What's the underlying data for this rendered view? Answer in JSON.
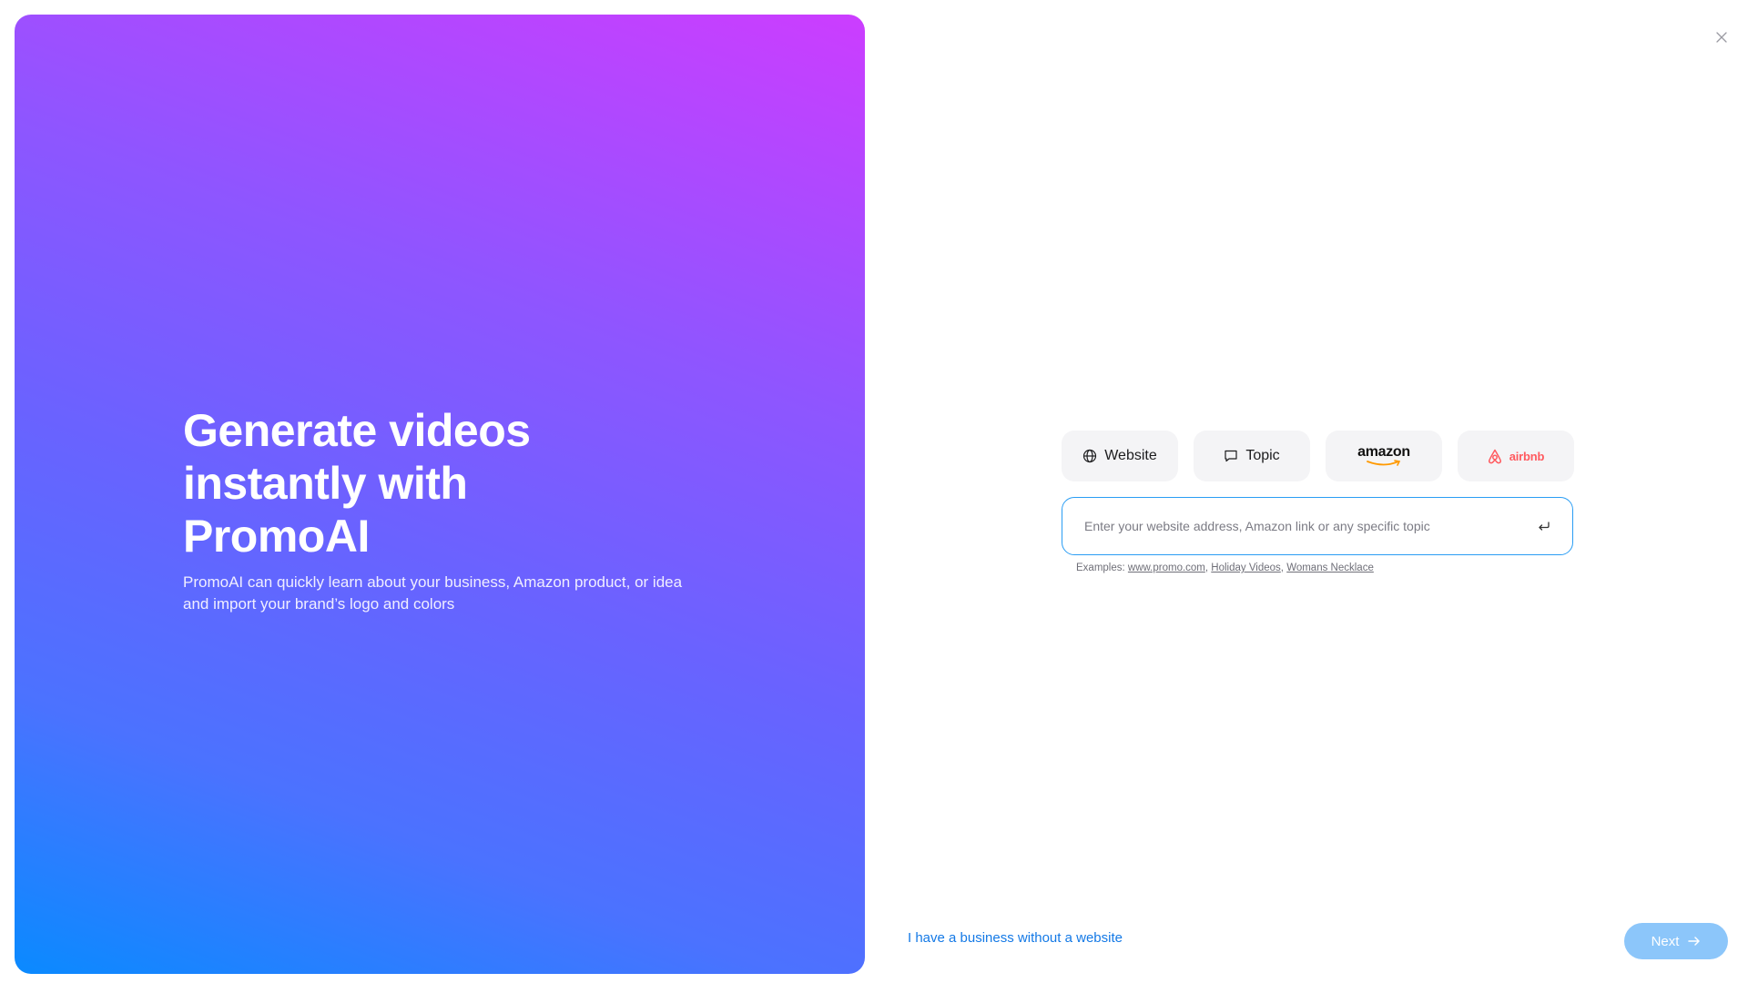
{
  "hero": {
    "title": "Generate videos instantly with PromoAI",
    "subtitle": "PromoAI can quickly learn about your business, Amazon product, or idea and import your brand’s logo and colors"
  },
  "tabs": [
    {
      "label": "Website",
      "icon": "globe-icon"
    },
    {
      "label": "Topic",
      "icon": "chat-bubble-icon"
    },
    {
      "label": "amazon",
      "icon": "amazon-logo"
    },
    {
      "label": "airbnb",
      "icon": "airbnb-logo"
    }
  ],
  "input": {
    "placeholder": "Enter your website address, Amazon link or any specific topic",
    "value": ""
  },
  "examples": {
    "label": "Examples:",
    "items": [
      "www.promo.com",
      "Holiday Videos",
      "Womans Necklace"
    ]
  },
  "footer": {
    "no_website_link": "I have a business without a website",
    "next_label": "Next"
  },
  "colors": {
    "accent": "#2a9df4",
    "link": "#1479e6",
    "next_button": "#8cc6fa",
    "gradient_top": "#cc3dff",
    "gradient_bottom": "#0a8aff"
  }
}
